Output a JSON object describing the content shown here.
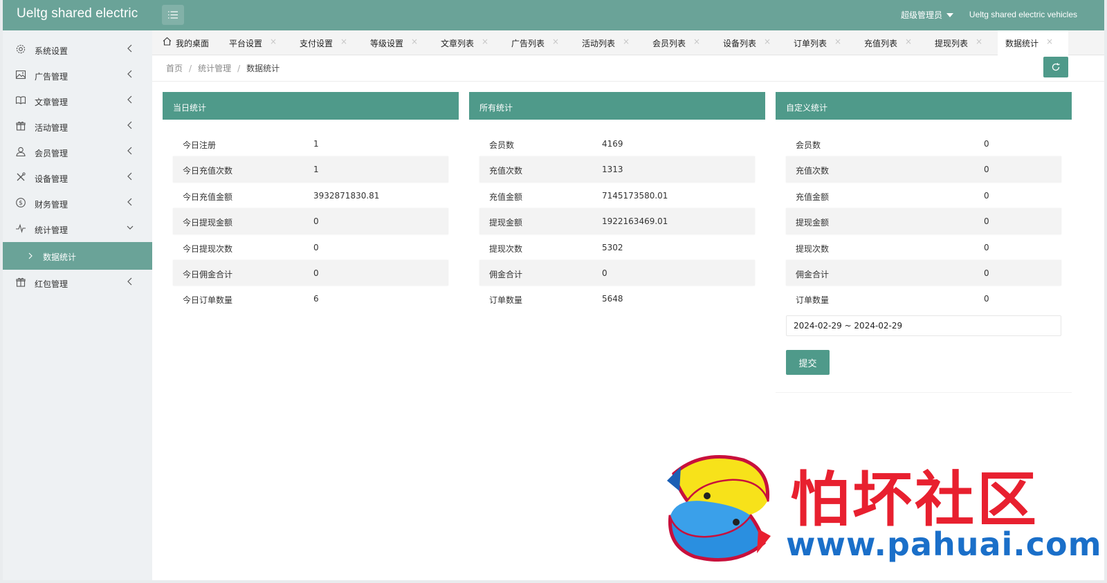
{
  "header": {
    "brand": "Ueltg shared electric",
    "user": "超级管理员",
    "site_name": "Ueltg shared electric vehicles"
  },
  "sidebar": {
    "items": [
      {
        "label": "系统设置",
        "icon": "gear-icon"
      },
      {
        "label": "广告管理",
        "icon": "image-icon"
      },
      {
        "label": "文章管理",
        "icon": "book-icon"
      },
      {
        "label": "活动管理",
        "icon": "gift-icon"
      },
      {
        "label": "会员管理",
        "icon": "user-icon"
      },
      {
        "label": "设备管理",
        "icon": "tools-icon"
      },
      {
        "label": "财务管理",
        "icon": "dollar-icon"
      },
      {
        "label": "统计管理",
        "icon": "pulse-icon"
      }
    ],
    "active_sub": "数据统计",
    "last_item": {
      "label": "红包管理",
      "icon": "gift-icon"
    }
  },
  "tabs": {
    "home": "我的桌面",
    "items": [
      "平台设置",
      "支付设置",
      "等级设置",
      "文章列表",
      "广告列表",
      "活动列表",
      "会员列表",
      "设备列表",
      "订单列表",
      "充值列表",
      "提现列表",
      "数据统计"
    ],
    "active": "数据统计",
    "close_glyph": "×"
  },
  "breadcrumb": {
    "items": [
      "首页",
      "统计管理",
      "数据统计"
    ],
    "separator": "/"
  },
  "panels": {
    "today": {
      "title": "当日统计",
      "rows": [
        {
          "k": "今日注册",
          "v": "1"
        },
        {
          "k": "今日充值次数",
          "v": "1"
        },
        {
          "k": "今日充值金额",
          "v": "3932871830.81"
        },
        {
          "k": "今日提现金额",
          "v": "0"
        },
        {
          "k": "今日提现次数",
          "v": "0"
        },
        {
          "k": "今日佣金合计",
          "v": "0"
        },
        {
          "k": "今日订单数量",
          "v": "6"
        }
      ]
    },
    "all": {
      "title": "所有统计",
      "rows": [
        {
          "k": "会员数",
          "v": "4169"
        },
        {
          "k": "充值次数",
          "v": "1313"
        },
        {
          "k": "充值金额",
          "v": "7145173580.01"
        },
        {
          "k": "提现金额",
          "v": "1922163469.01"
        },
        {
          "k": "提现次数",
          "v": "5302"
        },
        {
          "k": "佣金合计",
          "v": "0"
        },
        {
          "k": "订单数量",
          "v": "5648"
        }
      ]
    },
    "custom": {
      "title": "自定义统计",
      "rows": [
        {
          "k": "会员数",
          "v": "0"
        },
        {
          "k": "充值次数",
          "v": "0"
        },
        {
          "k": "充值金额",
          "v": "0"
        },
        {
          "k": "提现金额",
          "v": "0"
        },
        {
          "k": "提现次数",
          "v": "0"
        },
        {
          "k": "佣金合计",
          "v": "0"
        },
        {
          "k": "订单数量",
          "v": "0"
        }
      ],
      "date_range": "2024-02-29 ~ 2024-02-29",
      "submit": "提交"
    }
  },
  "watermark": {
    "text": "怕坏社区",
    "url": "www.pahuai.com"
  },
  "colors": {
    "header": "#6aa398",
    "panel_head": "#4f9a8a",
    "watermark_red": "#e8202f",
    "watermark_blue": "#1a6fc9"
  }
}
